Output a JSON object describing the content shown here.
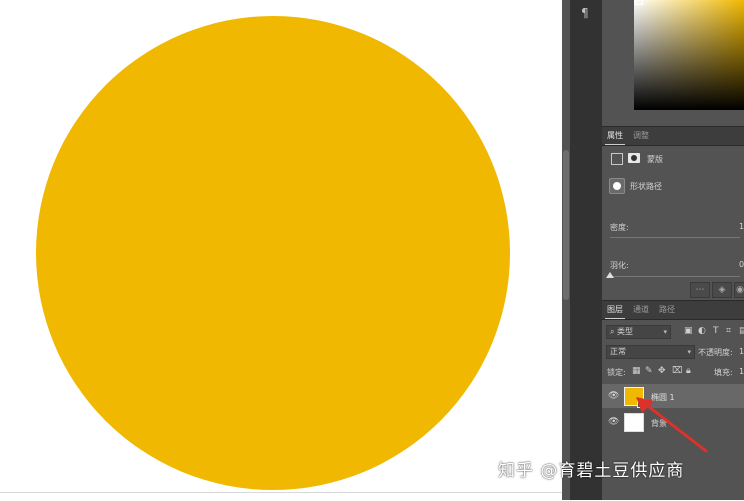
{
  "colors": {
    "fill": "#f0b800",
    "panel": "#535353",
    "panel_dark": "#323232",
    "arrow": "#e0302a"
  },
  "toolstrip": {
    "paragraph_icon": "¶"
  },
  "properties": {
    "tabs": [
      {
        "label": "属性"
      },
      {
        "label": "调整"
      }
    ],
    "mask_label": "蒙版",
    "shape_path_label": "形状路径",
    "density_label": "密度:",
    "density_value": "1",
    "feather_label": "羽化:",
    "feather_value": "0"
  },
  "layers": {
    "tabs": [
      {
        "label": "图层"
      },
      {
        "label": "通道"
      },
      {
        "label": "路径"
      }
    ],
    "filter_label": "类型",
    "blend_mode": "正常",
    "opacity_label": "不透明度:",
    "opacity_value": "1",
    "lock_label": "锁定:",
    "fill_label": "填充:",
    "fill_value": "1",
    "items": [
      {
        "name": "椭圆 1"
      },
      {
        "name": "背景"
      }
    ]
  },
  "watermark": "知乎 @育碧土豆供应商"
}
